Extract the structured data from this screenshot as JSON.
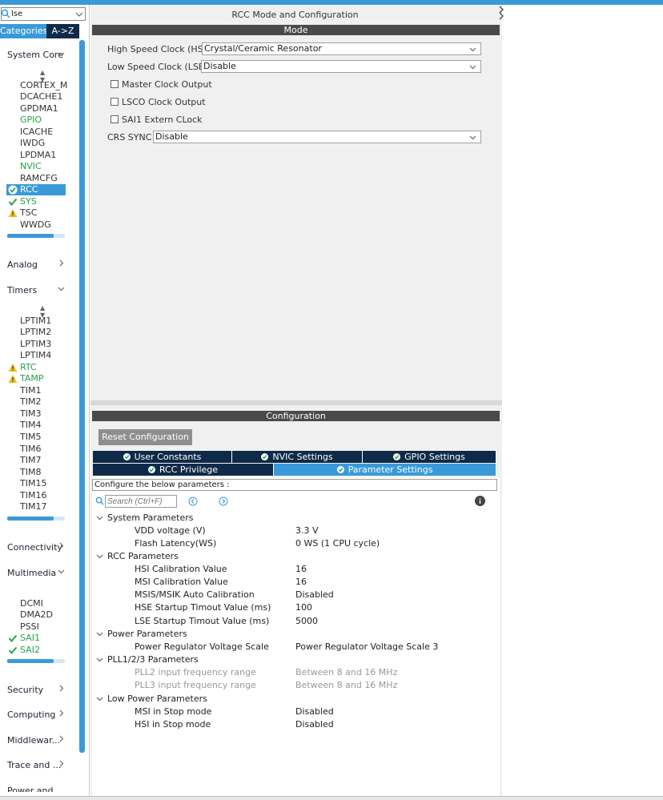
{
  "sidebar": {
    "search_value": "lse",
    "tabs": {
      "categories": "Categories",
      "az": "A->Z"
    },
    "categories": {
      "system_core": "System Core",
      "analog": "Analog",
      "timers": "Timers",
      "connectivity": "Connectivity",
      "multimedia": "Multimedia",
      "security": "Security",
      "computing": "Computing",
      "middleware": "Middlewar...",
      "trace": "Trace and ...",
      "power": "Power and ..."
    },
    "system_core_items": [
      "CORTEX_M",
      "DCACHE1",
      "GPDMA1",
      "GPIO",
      "ICACHE",
      "IWDG",
      "LPDMA1",
      "NVIC",
      "RAMCFG",
      "RCC",
      "SYS",
      "TSC",
      "WWDG"
    ],
    "timer_items": [
      "LPTIM1",
      "LPTIM2",
      "LPTIM3",
      "LPTIM4",
      "RTC",
      "TAMP",
      "TIM1",
      "TIM2",
      "TIM3",
      "TIM4",
      "TIM5",
      "TIM6",
      "TIM7",
      "TIM8",
      "TIM15",
      "TIM16",
      "TIM17"
    ],
    "multimedia_items": [
      "DCMI",
      "DMA2D",
      "PSSI",
      "SAI1",
      "SAI2"
    ]
  },
  "mode_panel": {
    "title": "RCC Mode and Configuration",
    "bar": "Mode",
    "hse_label": "High Speed Clock (HSE)",
    "hse_value": "Crystal/Ceramic Resonator",
    "lse_label": "Low Speed Clock (LSE)",
    "lse_value": "Disable",
    "master_clock": "Master Clock Output",
    "lsco": "LSCO Clock Output",
    "sai1_ext": "SAI1 Extern CLock",
    "crs_label": "CRS SYNC",
    "crs_value": "Disable"
  },
  "config_panel": {
    "bar": "Configuration",
    "reset_button": "Reset Configuration",
    "tabs": {
      "user_constants": "User Constants",
      "nvic": "NVIC Settings",
      "gpio": "GPIO Settings",
      "rcc_privilege": "RCC Privilege",
      "parameter": "Parameter Settings"
    },
    "description": "Configure the below parameters :",
    "search_placeholder": "Search (Ctrl+F)",
    "groups": {
      "system": "System Parameters",
      "rcc": "RCC Parameters",
      "power": "Power Parameters",
      "pll": "PLL1/2/3 Parameters",
      "lowpower": "Low Power Parameters"
    },
    "params": {
      "vdd_name": "VDD voltage (V)",
      "vdd_val": "3.3 V",
      "flash_name": "Flash Latency(WS)",
      "flash_val": "0 WS (1 CPU cycle)",
      "hsi_cal_name": "HSI Calibration Value",
      "hsi_cal_val": "16",
      "msi_cal_name": "MSI Calibration Value",
      "msi_cal_val": "16",
      "msis_name": "MSIS/MSIK Auto Calibration",
      "msis_val": "Disabled",
      "hse_st_name": "HSE Startup Timout Value (ms)",
      "hse_st_val": "100",
      "lse_st_name": "LSE Startup Timout Value (ms)",
      "lse_st_val": "5000",
      "prvs_name": "Power Regulator Voltage Scale",
      "prvs_val": "Power Regulator Voltage Scale 3",
      "pll2_name": "PLL2 input frequency range",
      "pll2_val": "Between 8 and 16 MHz",
      "pll3_name": "PLL3 input frequency range",
      "pll3_val": "Between 8 and 16 MHz",
      "msi_stop_name": "MSI in Stop mode",
      "msi_stop_val": "Disabled",
      "hsi_stop_name": "HSI in Stop mode",
      "hsi_stop_val": "Disabled"
    }
  },
  "colors": {
    "accent": "#3a9ad9",
    "dark_tab": "#0f2a48",
    "ok_green": "#28a04a",
    "warn": "#f0c020"
  }
}
